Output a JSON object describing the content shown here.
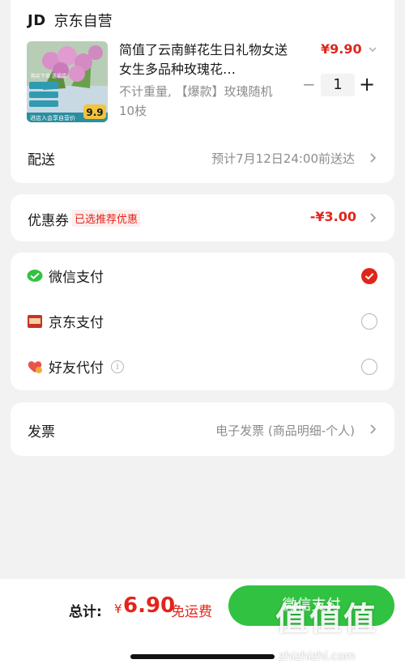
{
  "shop": {
    "logo": "JD",
    "name": "京东自营"
  },
  "product": {
    "title": "简值了云南鲜花生日礼物女送女生多品种玫瑰花…",
    "spec": "不计重量, 【爆款】玫瑰随机10枝",
    "price": "¥9.90",
    "quantity": "1",
    "minus": "−",
    "plus": "+",
    "image_badge_price": "9.9",
    "image_caption": "购买下单 送福袋",
    "image_footer": "进店入会享自营价",
    "colors": {
      "petal": "#d98fc7",
      "leaf": "#5d8f43",
      "badge": "#f2c43a"
    }
  },
  "delivery": {
    "label": "配送",
    "value": "预计7月12日24:00前送达"
  },
  "coupon": {
    "label": "优惠券",
    "tag": "已选推荐优惠",
    "value": "-¥3.00"
  },
  "payment": {
    "options": [
      {
        "label": "微信支付",
        "icon": "wechat-pay-icon",
        "selected": true
      },
      {
        "label": "京东支付",
        "icon": "jd-pay-icon",
        "selected": false
      },
      {
        "label": "好友代付",
        "icon": "friend-pay-icon",
        "selected": false,
        "info_icon": "info-icon"
      }
    ]
  },
  "invoice": {
    "label": "发票",
    "value": "电子发票 (商品明细-个人)"
  },
  "footer": {
    "total_label": "总计:",
    "currency": "¥",
    "total_amount": "6.90",
    "shipping_note": "免运费",
    "pay_button": "微信支付"
  },
  "watermark": {
    "glyphs": "值值值",
    "url": "zhizhizhi.com"
  },
  "colors": {
    "accent_red": "#e1251b",
    "wechat_green": "#31c241",
    "background": "#f2f2f2"
  }
}
